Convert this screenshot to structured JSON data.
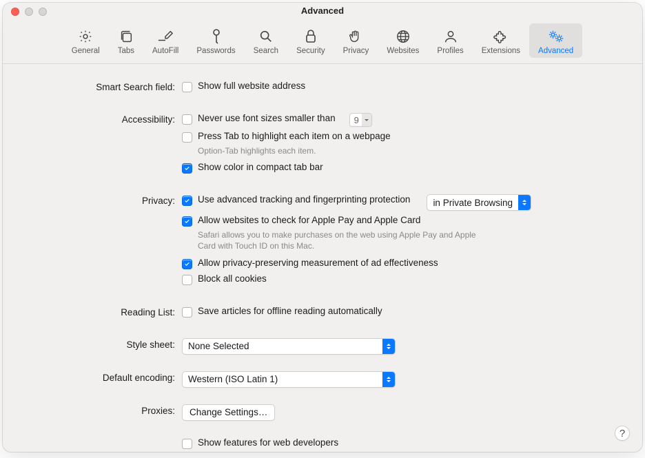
{
  "window": {
    "title": "Advanced"
  },
  "tabs": [
    {
      "id": "general",
      "label": "General"
    },
    {
      "id": "tabs",
      "label": "Tabs"
    },
    {
      "id": "autofill",
      "label": "AutoFill"
    },
    {
      "id": "passwords",
      "label": "Passwords"
    },
    {
      "id": "search",
      "label": "Search"
    },
    {
      "id": "security",
      "label": "Security"
    },
    {
      "id": "privacy",
      "label": "Privacy"
    },
    {
      "id": "websites",
      "label": "Websites"
    },
    {
      "id": "profiles",
      "label": "Profiles"
    },
    {
      "id": "extensions",
      "label": "Extensions"
    },
    {
      "id": "advanced",
      "label": "Advanced"
    }
  ],
  "activeTab": "advanced",
  "sections": {
    "smartSearch": {
      "label": "Smart Search field:",
      "fullAddress": {
        "label": "Show full website address",
        "checked": false
      }
    },
    "accessibility": {
      "label": "Accessibility:",
      "minFont": {
        "label": "Never use font sizes smaller than",
        "checked": false,
        "value": "9"
      },
      "pressTab": {
        "label": "Press Tab to highlight each item on a webpage",
        "checked": false,
        "hint": "Option-Tab highlights each item."
      },
      "compactColor": {
        "label": "Show color in compact tab bar",
        "checked": true
      }
    },
    "privacy": {
      "label": "Privacy:",
      "tracking": {
        "label": "Use advanced tracking and fingerprinting protection",
        "checked": true,
        "dropdown": "in Private Browsing"
      },
      "applepay": {
        "label": "Allow websites to check for Apple Pay and Apple Card",
        "checked": true,
        "hint": "Safari allows you to make purchases on the web using Apple Pay and Apple Card with Touch ID on this Mac."
      },
      "admeasure": {
        "label": "Allow privacy-preserving measurement of ad effectiveness",
        "checked": true
      },
      "blockcookies": {
        "label": "Block all cookies",
        "checked": false
      }
    },
    "readingList": {
      "label": "Reading List:",
      "saveOffline": {
        "label": "Save articles for offline reading automatically",
        "checked": false
      }
    },
    "styleSheet": {
      "label": "Style sheet:",
      "value": "None Selected"
    },
    "encoding": {
      "label": "Default encoding:",
      "value": "Western (ISO Latin 1)"
    },
    "proxies": {
      "label": "Proxies:",
      "button": "Change Settings…"
    },
    "devmenu": {
      "label": "Show features for web developers",
      "checked": false
    }
  },
  "helpGlyph": "?"
}
